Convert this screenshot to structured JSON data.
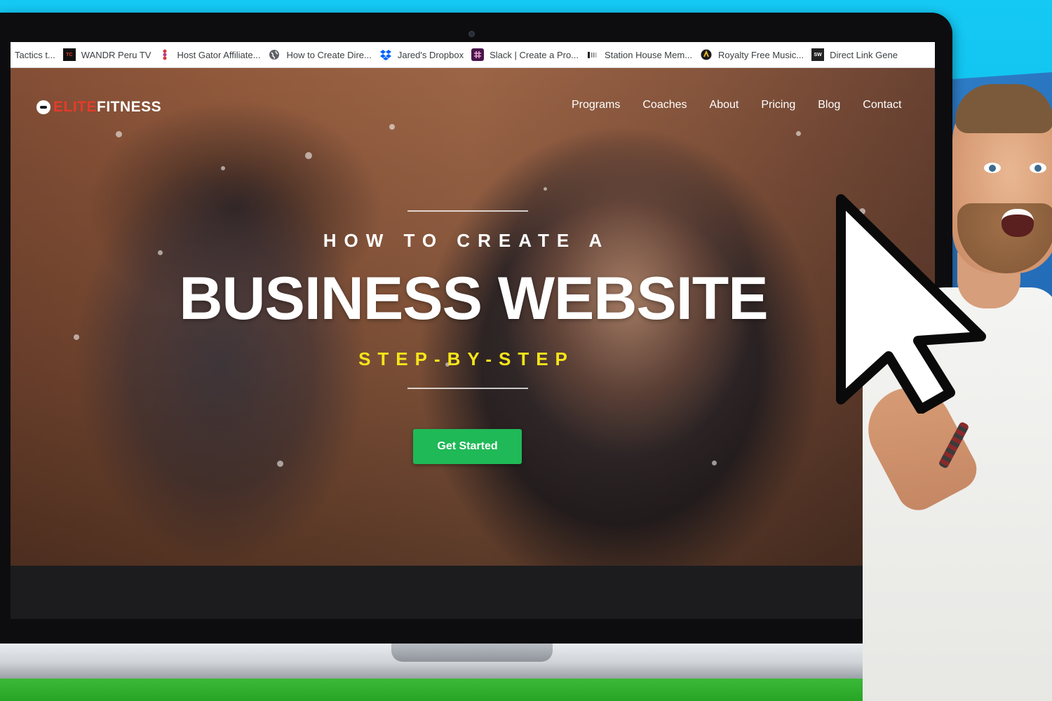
{
  "bookmarks": [
    {
      "label": "Tactics t...",
      "icon": "page-icon",
      "color": "#ffffff"
    },
    {
      "label": "WANDR Peru TV",
      "icon": "wandr-icon",
      "color": "#111111"
    },
    {
      "label": "Host Gator Affiliate...",
      "icon": "hostgator-icon",
      "color": "#d63b3b"
    },
    {
      "label": "How to Create Dire...",
      "icon": "globe-icon",
      "color": "#5f6368"
    },
    {
      "label": "Jared's Dropbox",
      "icon": "dropbox-icon",
      "color": "#0061fe"
    },
    {
      "label": "Slack | Create a Pro...",
      "icon": "slack-icon",
      "color": "#4a154b"
    },
    {
      "label": "Station House Mem...",
      "icon": "station-house-icon",
      "color": "#222222"
    },
    {
      "label": "Royalty Free Music...",
      "icon": "music-icon",
      "color": "#1a1a1a"
    },
    {
      "label": "Direct Link Gene",
      "icon": "direct-link-icon",
      "color": "#222222"
    }
  ],
  "site": {
    "logo_elite": "ELITE",
    "logo_fitness": "FITNESS",
    "logo_elite_color": "#e53b2c",
    "nav": [
      "Programs",
      "Coaches",
      "About",
      "Pricing",
      "Blog",
      "Contact"
    ],
    "pre_heading": "HOW TO CREATE A",
    "heading": "BUSINESS WEBSITE",
    "sub_heading": "STEP-BY-STEP",
    "sub_heading_color": "#f5e51a",
    "cta_label": "Get Started",
    "cta_color": "#1fb957"
  },
  "scene": {
    "background_color": "#14c9f4",
    "panel_color": "#2f7ec8",
    "floor_color": "#3dbb3a"
  }
}
